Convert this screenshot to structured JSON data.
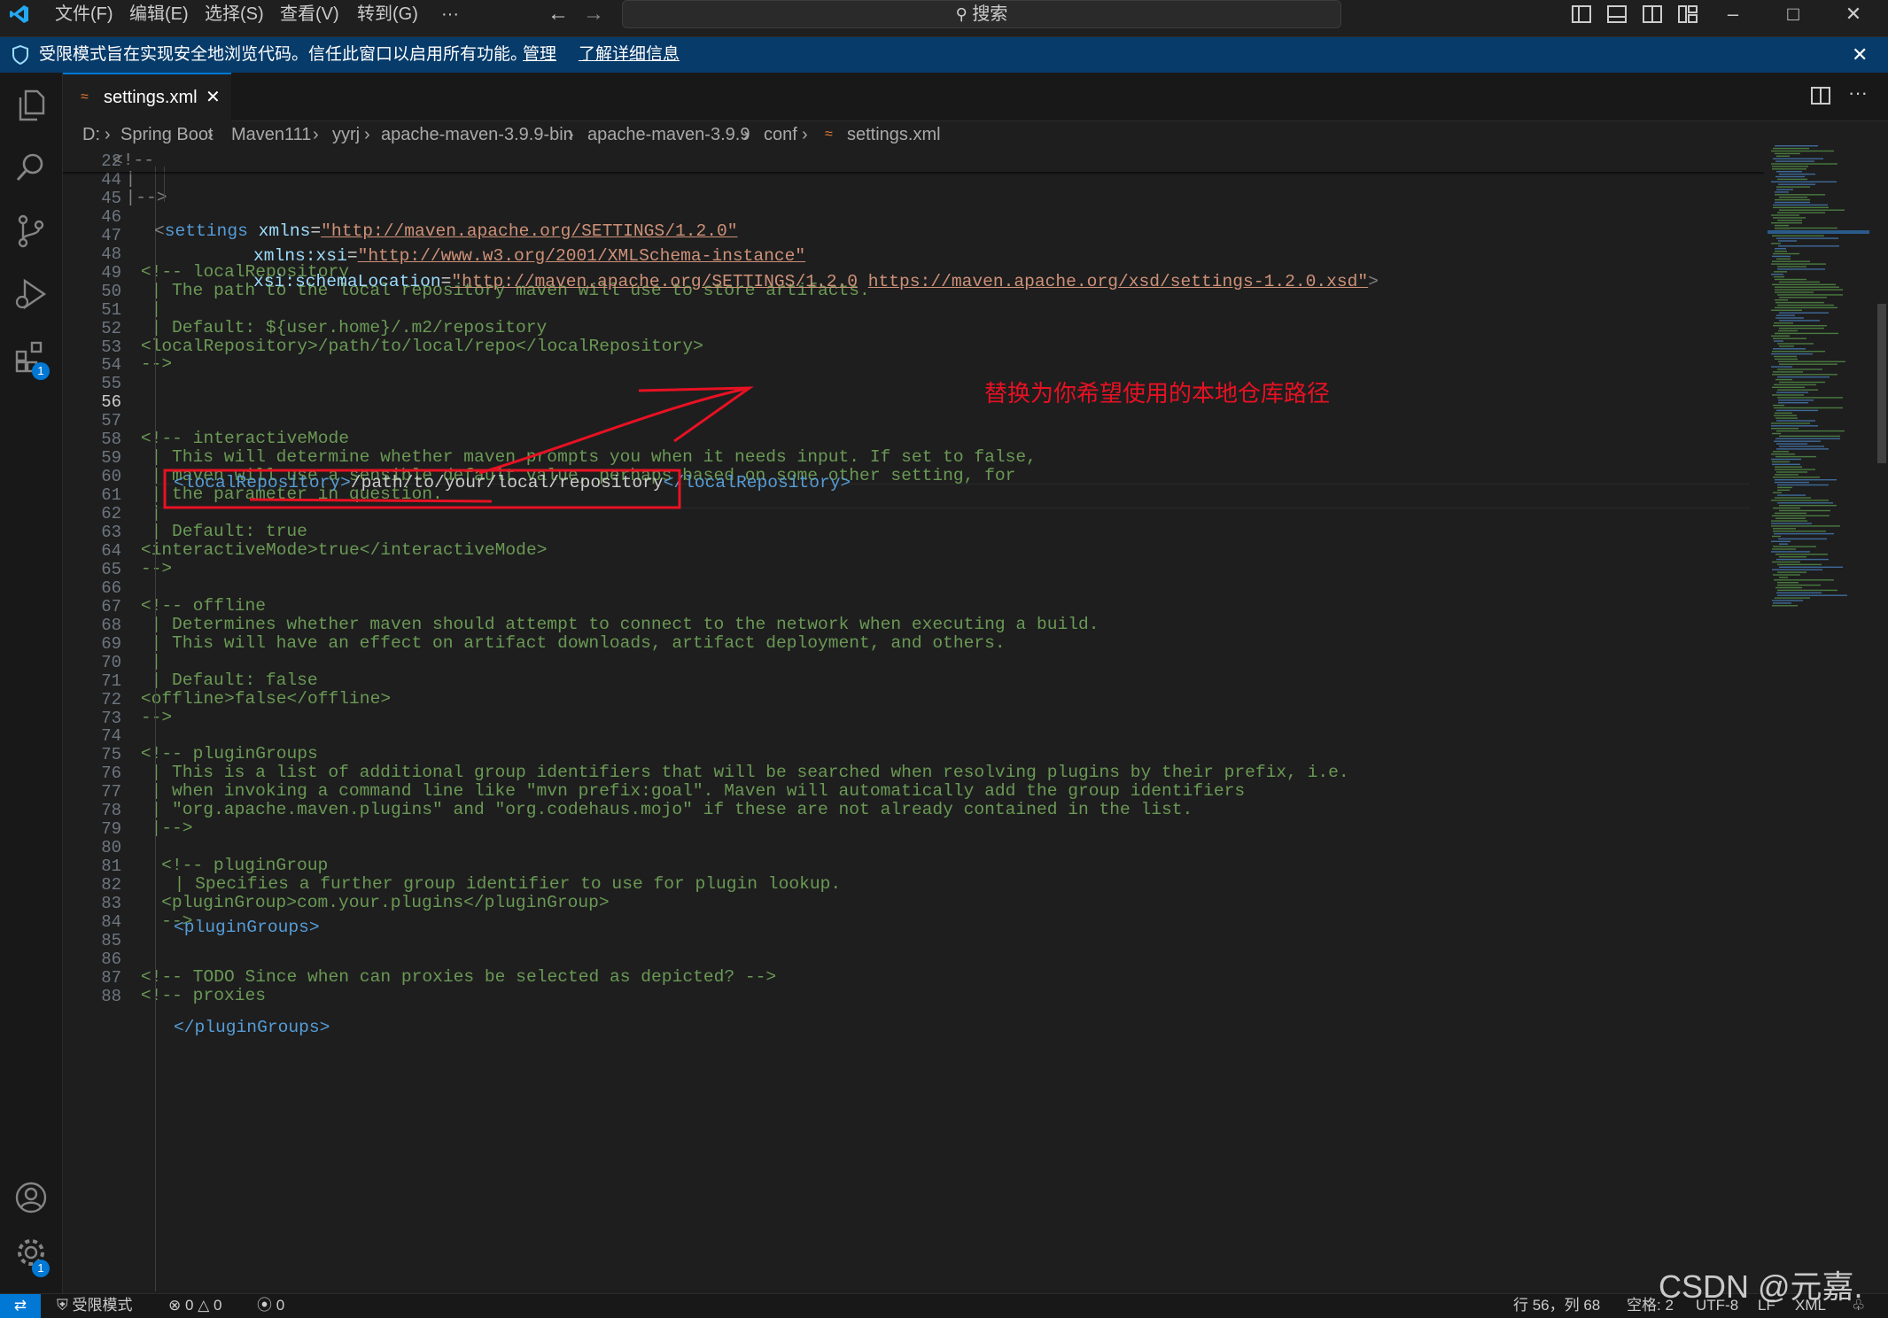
{
  "titlebar": {
    "menu": [
      "文件(F)",
      "编辑(E)",
      "选择(S)",
      "查看(V)",
      "转到(G)",
      "···"
    ],
    "search_placeholder": "搜索"
  },
  "banner": {
    "message": "受限模式旨在实现安全地浏览代码。信任此窗口以启用所有功能。",
    "manage_link": "管理",
    "learn_more_link": "了解详细信息"
  },
  "activitybar": {
    "extensions_badge": "1",
    "settings_badge": "1"
  },
  "tab": {
    "filename": "settings.xml"
  },
  "breadcrumb": [
    "D:",
    "Spring Boot",
    "Maven111",
    "yyrj",
    "apache-maven-3.9.9-bin",
    "apache-maven-3.9.9",
    "conf",
    "settings.xml"
  ],
  "editor": {
    "lines": [
      {
        "n": "22",
        "text": "<!--",
        "cls": "gray",
        "indent": 0
      },
      {
        "n": "44",
        "text": "|",
        "cls": "gray",
        "indent": 1
      },
      {
        "n": "45",
        "text": "|-->",
        "cls": "gray",
        "indent": 1
      },
      {
        "n": "46",
        "text": "",
        "cls": "",
        "indent": 0
      },
      {
        "n": "47",
        "text": "",
        "cls": "",
        "indent": 0
      },
      {
        "n": "48",
        "text": "",
        "cls": "",
        "indent": 0
      },
      {
        "n": "49",
        "text": "<!-- localRepository",
        "cls": "cm",
        "indent": 2
      },
      {
        "n": "50",
        "text": "| The path to the local repository maven will use to store artifacts.",
        "cls": "cm",
        "indent": 3
      },
      {
        "n": "51",
        "text": "|",
        "cls": "cm",
        "indent": 3
      },
      {
        "n": "52",
        "text": "| Default: ${user.home}/.m2/repository",
        "cls": "cm",
        "indent": 3
      },
      {
        "n": "53",
        "text": "<localRepository>/path/to/local/repo</localRepository>",
        "cls": "cm",
        "indent": 2
      },
      {
        "n": "54",
        "text": "-->",
        "cls": "cm",
        "indent": 2
      },
      {
        "n": "55",
        "text": "",
        "cls": "",
        "indent": 0
      },
      {
        "n": "56",
        "text": "",
        "cls": "",
        "indent": 0
      },
      {
        "n": "57",
        "text": "",
        "cls": "",
        "indent": 0
      },
      {
        "n": "58",
        "text": "<!-- interactiveMode",
        "cls": "cm",
        "indent": 2
      },
      {
        "n": "59",
        "text": "| This will determine whether maven prompts you when it needs input. If set to false,",
        "cls": "cm",
        "indent": 3
      },
      {
        "n": "60",
        "text": "| maven will use a sensible default value, perhaps based on some other setting, for",
        "cls": "cm",
        "indent": 3
      },
      {
        "n": "61",
        "text": "| the parameter in question.",
        "cls": "cm",
        "indent": 3
      },
      {
        "n": "62",
        "text": "|",
        "cls": "cm",
        "indent": 3
      },
      {
        "n": "63",
        "text": "| Default: true",
        "cls": "cm",
        "indent": 3
      },
      {
        "n": "64",
        "text": "<interactiveMode>true</interactiveMode>",
        "cls": "cm",
        "indent": 2
      },
      {
        "n": "65",
        "text": "-->",
        "cls": "cm",
        "indent": 2
      },
      {
        "n": "66",
        "text": "",
        "cls": "",
        "indent": 0
      },
      {
        "n": "67",
        "text": "<!-- offline",
        "cls": "cm",
        "indent": 2
      },
      {
        "n": "68",
        "text": "| Determines whether maven should attempt to connect to the network when executing a build.",
        "cls": "cm",
        "indent": 3
      },
      {
        "n": "69",
        "text": "| This will have an effect on artifact downloads, artifact deployment, and others.",
        "cls": "cm",
        "indent": 3
      },
      {
        "n": "70",
        "text": "|",
        "cls": "cm",
        "indent": 3
      },
      {
        "n": "71",
        "text": "| Default: false",
        "cls": "cm",
        "indent": 3
      },
      {
        "n": "72",
        "text": "<offline>false</offline>",
        "cls": "cm",
        "indent": 2
      },
      {
        "n": "73",
        "text": "-->",
        "cls": "cm",
        "indent": 2
      },
      {
        "n": "74",
        "text": "",
        "cls": "",
        "indent": 0
      },
      {
        "n": "75",
        "text": "<!-- pluginGroups",
        "cls": "cm",
        "indent": 2
      },
      {
        "n": "76",
        "text": "| This is a list of additional group identifiers that will be searched when resolving plugins by their prefix, i.e.",
        "cls": "cm",
        "indent": 3
      },
      {
        "n": "77",
        "text": "| when invoking a command line like \"mvn prefix:goal\". Maven will automatically add the group identifiers",
        "cls": "cm",
        "indent": 3
      },
      {
        "n": "78",
        "text": "| \"org.apache.maven.plugins\" and \"org.codehaus.mojo\" if these are not already contained in the list.",
        "cls": "cm",
        "indent": 3
      },
      {
        "n": "79",
        "text": "|-->",
        "cls": "cm",
        "indent": 3
      },
      {
        "n": "80",
        "text": "",
        "cls": "",
        "indent": 0
      },
      {
        "n": "81",
        "text": "<!-- pluginGroup",
        "cls": "cm",
        "indent": 4
      },
      {
        "n": "82",
        "text": "| Specifies a further group identifier to use for plugin lookup.",
        "cls": "cm",
        "indent": 5
      },
      {
        "n": "83",
        "text": "<pluginGroup>com.your.plugins</pluginGroup>",
        "cls": "cm",
        "indent": 4
      },
      {
        "n": "84",
        "text": "-->",
        "cls": "cm",
        "indent": 4
      },
      {
        "n": "85",
        "text": "",
        "cls": "",
        "indent": 0
      },
      {
        "n": "86",
        "text": "",
        "cls": "",
        "indent": 0
      },
      {
        "n": "87",
        "text": "<!-- TODO Since when can proxies be selected as depicted? -->",
        "cls": "cm",
        "indent": 2
      },
      {
        "n": "88",
        "text": "<!-- proxies",
        "cls": "cm",
        "indent": 2
      }
    ],
    "settings_open": {
      "tag": "settings",
      "xmlns_attr": "xmlns",
      "xmlns_val": "\"http://maven.apache.org/SETTINGS/1.2.0\"",
      "xsi_attr": "xmlns:xsi",
      "xsi_val": "\"http://www.w3.org/2001/XMLSchema-instance\"",
      "schema_attr": "xsi:schemaLocation",
      "schema_val1": "\"http://maven.apache.org/SETTINGS/1.2.0",
      "schema_val2": "https://maven.apache.org/xsd/settings-1.2.0.xsd\""
    },
    "local_repo": {
      "open_tag": "<localRepository>",
      "value": "/path/to/your/local/repository",
      "close_tag": "</localRepository>"
    },
    "plugin_groups": {
      "open_tag": "<pluginGroups>",
      "close_tag": "</pluginGroups>"
    }
  },
  "annotation": {
    "text": "替换为你希望使用的本地仓库路径"
  },
  "statusbar": {
    "restricted": "受限模式",
    "errors": "0",
    "warnings": "0",
    "ports": "0",
    "position": "行 56，列 68",
    "spaces": "空格: 2",
    "encoding": "UTF-8",
    "eol": "LF",
    "language": "XML"
  },
  "watermark": "CSDN @元嘉."
}
